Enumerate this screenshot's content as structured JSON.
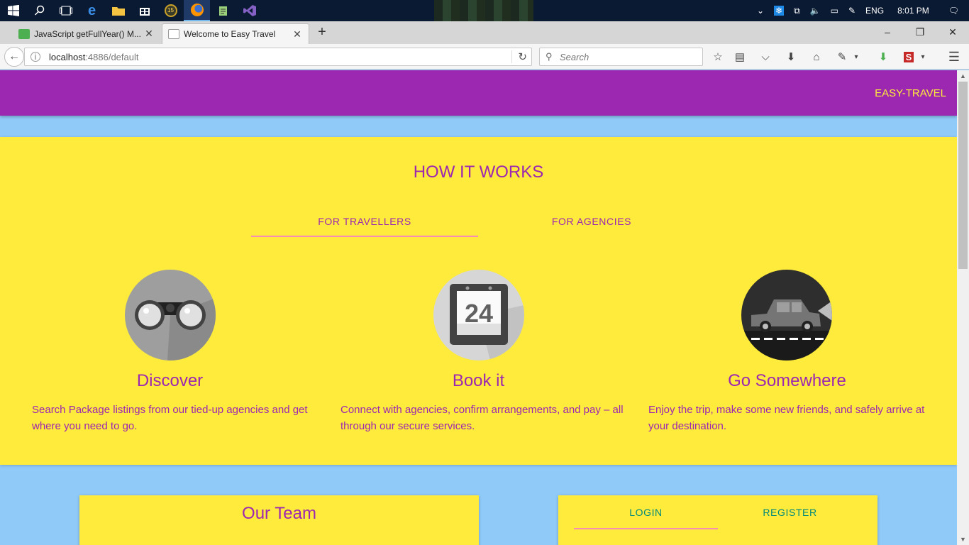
{
  "taskbar": {
    "tray": {
      "lang": "ENG",
      "time": "8:01 PM"
    }
  },
  "browser": {
    "tabs": [
      {
        "title": "JavaScript getFullYear() M..."
      },
      {
        "title": "Welcome to Easy Travel"
      }
    ],
    "url": {
      "host": "localhost",
      "rest": ":4886/default"
    },
    "search_placeholder": "Search"
  },
  "page": {
    "brand": "EASY-TRAVEL",
    "how_it_works": {
      "title": "HOW IT WORKS",
      "tabs": [
        "FOR TRAVELLERS",
        "FOR AGENCIES"
      ],
      "features": [
        {
          "title": "Discover",
          "text": "Search Package listings from our tied-up agencies and get where you need to go.",
          "icon": "binoculars-icon"
        },
        {
          "title": "Book it",
          "text": "Connect with agencies, confirm arrangements, and pay – all through our secure services.",
          "icon": "calendar-icon",
          "calendar_day": "24"
        },
        {
          "title": "Go Somewhere",
          "text": "Enjoy the trip, make some new friends, and safely arrive at your destination.",
          "icon": "car-icon"
        }
      ]
    },
    "team": {
      "title": "Our Team"
    },
    "auth": {
      "tabs": [
        "LOGIN",
        "REGISTER"
      ]
    }
  },
  "colors": {
    "primary": "#9c27b0",
    "accent": "#ffeb3b",
    "background": "#90caf9",
    "tab_indicator": "#f48fb1",
    "teal": "#00897b"
  }
}
